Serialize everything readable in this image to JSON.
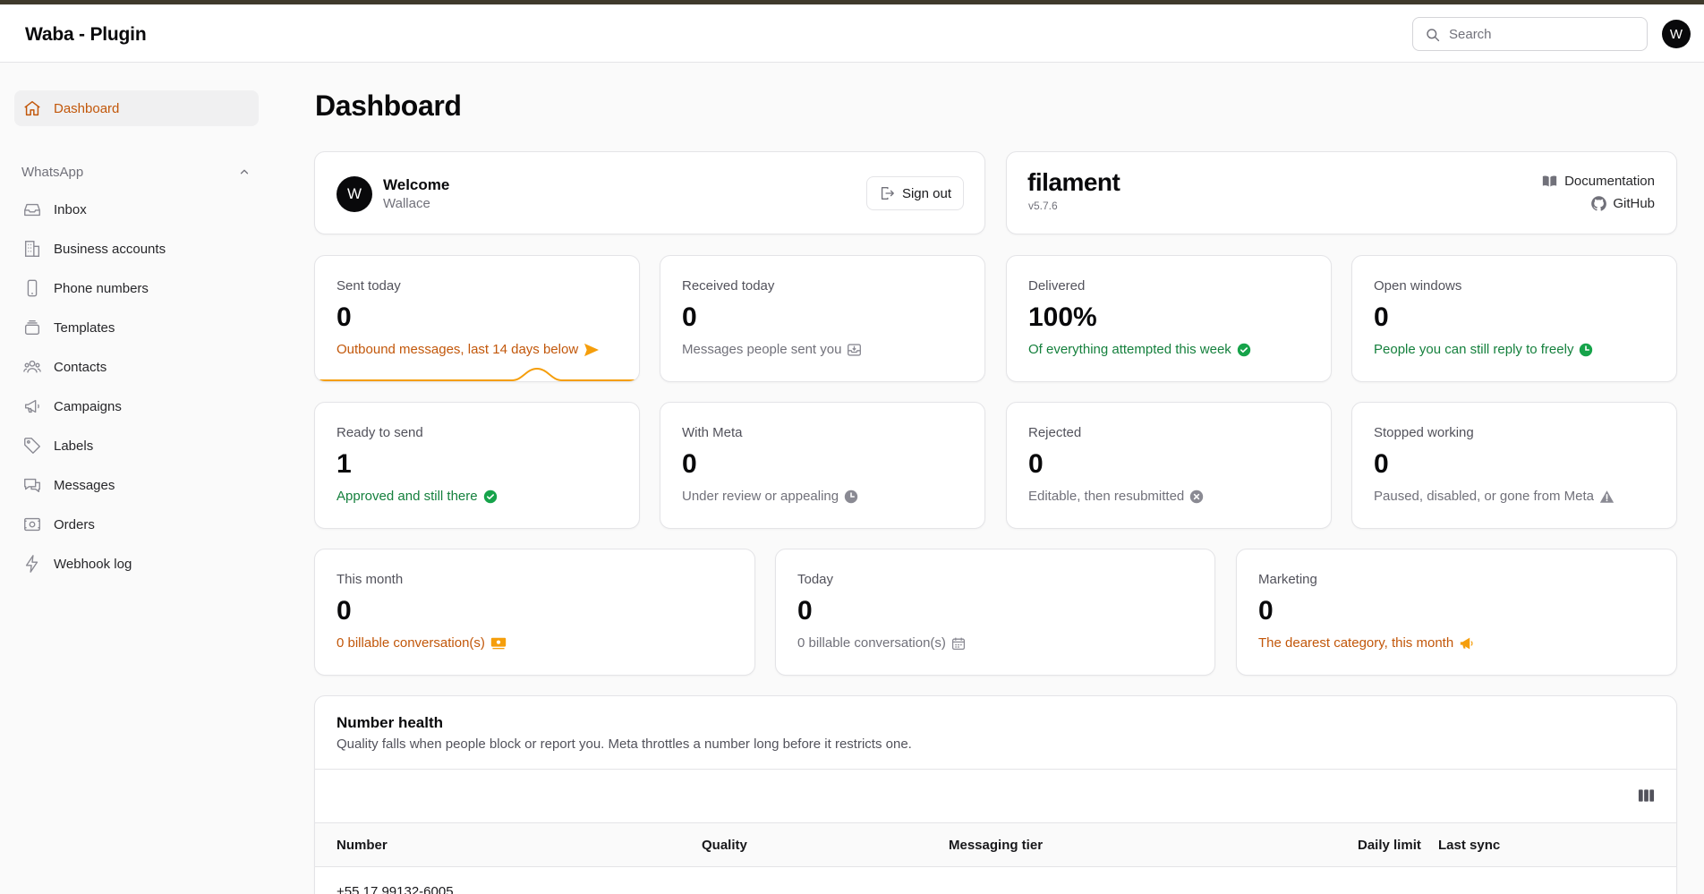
{
  "app": {
    "title": "Waba - Plugin",
    "user_initial": "W"
  },
  "search": {
    "placeholder": "Search",
    "value": ""
  },
  "sidebar": {
    "dashboard": {
      "label": "Dashboard",
      "icon": "home-icon"
    },
    "group": {
      "label": "WhatsApp",
      "icon": "chevron-up-icon"
    },
    "items": [
      {
        "label": "Inbox",
        "icon": "inbox-icon"
      },
      {
        "label": "Business accounts",
        "icon": "building-icon"
      },
      {
        "label": "Phone numbers",
        "icon": "phone-icon"
      },
      {
        "label": "Templates",
        "icon": "templates-icon"
      },
      {
        "label": "Contacts",
        "icon": "contacts-icon"
      },
      {
        "label": "Campaigns",
        "icon": "megaphone-icon"
      },
      {
        "label": "Labels",
        "icon": "tag-icon"
      },
      {
        "label": "Messages",
        "icon": "messages-icon"
      },
      {
        "label": "Orders",
        "icon": "orders-icon"
      },
      {
        "label": "Webhook log",
        "icon": "bolt-icon"
      }
    ]
  },
  "page": {
    "title": "Dashboard"
  },
  "welcome": {
    "title": "Welcome",
    "name": "Wallace",
    "initial": "W",
    "sign_out": "Sign out"
  },
  "filament": {
    "logo": "filament",
    "version": "v5.7.6",
    "documentation": "Documentation",
    "github": "GitHub"
  },
  "stats": [
    {
      "label": "Sent today",
      "value": "0",
      "desc": "Outbound messages, last 14 days below",
      "tone": "orange",
      "icon": "send-icon"
    },
    {
      "label": "Received today",
      "value": "0",
      "desc": "Messages people sent you",
      "tone": "gray",
      "icon": "inbox-tray-icon"
    },
    {
      "label": "Delivered",
      "value": "100%",
      "desc": "Of everything attempted this week",
      "tone": "green",
      "icon": "check-circle-icon"
    },
    {
      "label": "Open windows",
      "value": "0",
      "desc": "People you can still reply to freely",
      "tone": "green",
      "icon": "clock-icon"
    },
    {
      "label": "Ready to send",
      "value": "1",
      "desc": "Approved and still there",
      "tone": "green",
      "icon": "check-circle-icon"
    },
    {
      "label": "With Meta",
      "value": "0",
      "desc": "Under review or appealing",
      "tone": "gray",
      "icon": "clock-icon"
    },
    {
      "label": "Rejected",
      "value": "0",
      "desc": "Editable, then resubmitted",
      "tone": "gray",
      "icon": "x-circle-icon"
    },
    {
      "label": "Stopped working",
      "value": "0",
      "desc": "Paused, disabled, or gone from Meta",
      "tone": "gray",
      "icon": "warning-icon"
    }
  ],
  "billing": [
    {
      "label": "This month",
      "value": "0",
      "desc": "0 billable conversation(s)",
      "tone": "orange",
      "icon": "banknotes-icon"
    },
    {
      "label": "Today",
      "value": "0",
      "desc": "0 billable conversation(s)",
      "tone": "gray",
      "icon": "calendar-icon"
    },
    {
      "label": "Marketing",
      "value": "0",
      "desc": "The dearest category, this month",
      "tone": "orange",
      "icon": "megaphone-icon"
    }
  ],
  "number_health": {
    "title": "Number health",
    "description": "Quality falls when people block or report you. Meta throttles a number long before it restricts one.",
    "columns": [
      "Number",
      "Quality",
      "Messaging tier",
      "Daily limit",
      "Last sync"
    ],
    "rows": [
      {
        "number": "+55 17 99132-6005"
      }
    ]
  },
  "colors": {
    "accent": "#c2570a",
    "accent_bright": "#f59e0b",
    "success": "#16a34a",
    "text": "#09090b",
    "muted": "#71717a"
  }
}
